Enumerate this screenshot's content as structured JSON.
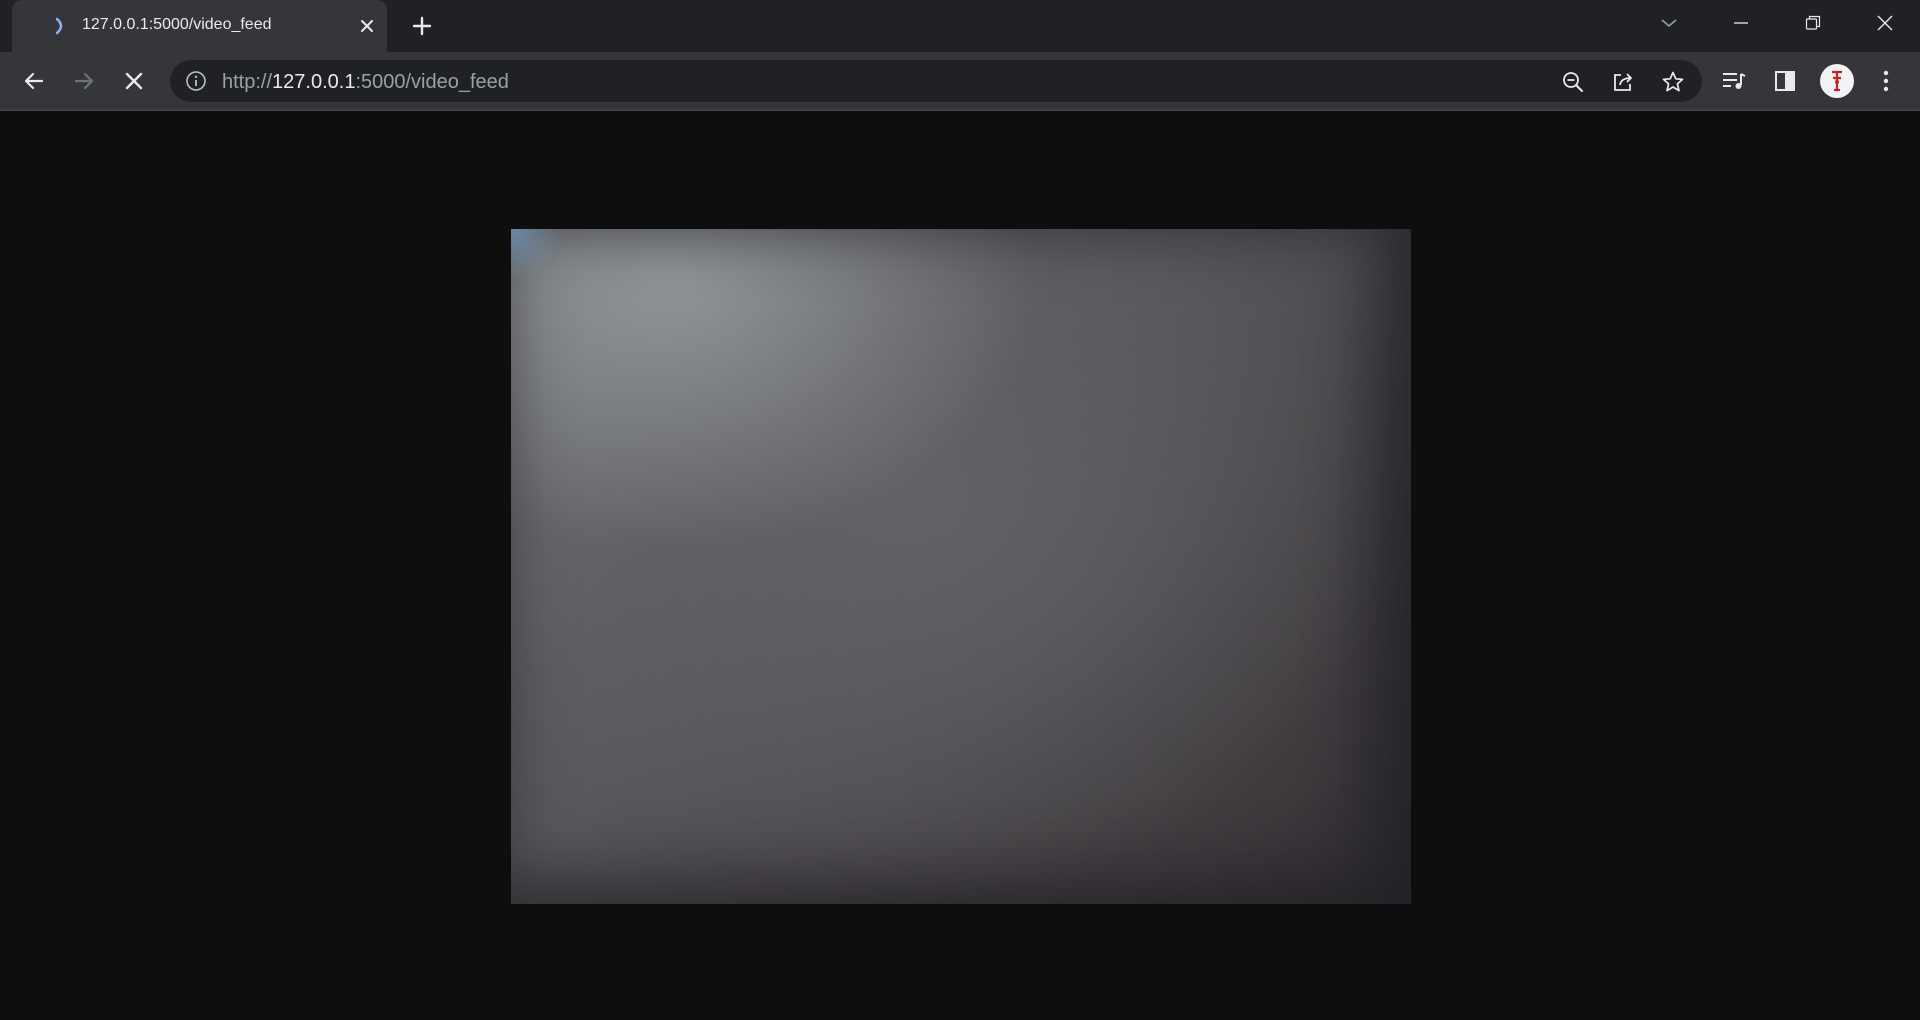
{
  "browser": {
    "tab": {
      "title": "127.0.0.1:5000/video_feed"
    },
    "address_bar": {
      "scheme": "http://",
      "host": "127.0.0.1",
      "rest": ":5000/video_feed"
    }
  },
  "page": {
    "content": "video_feed_stream"
  }
}
